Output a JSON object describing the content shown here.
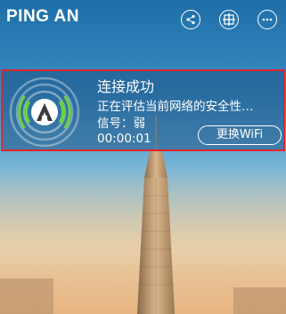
{
  "header": {
    "logo": "PING AN",
    "icons": [
      "share-icon",
      "grid-icon",
      "more-icon"
    ]
  },
  "connection": {
    "title": "连接成功",
    "status": "正在评估当前网络的安全性…",
    "signal": "信号：弱",
    "timer": "00:00:01",
    "change_wifi": "更换WiFi"
  },
  "colors": {
    "highlight_border": "#e5242a",
    "wifi_ring_green": "#6cd23a"
  }
}
